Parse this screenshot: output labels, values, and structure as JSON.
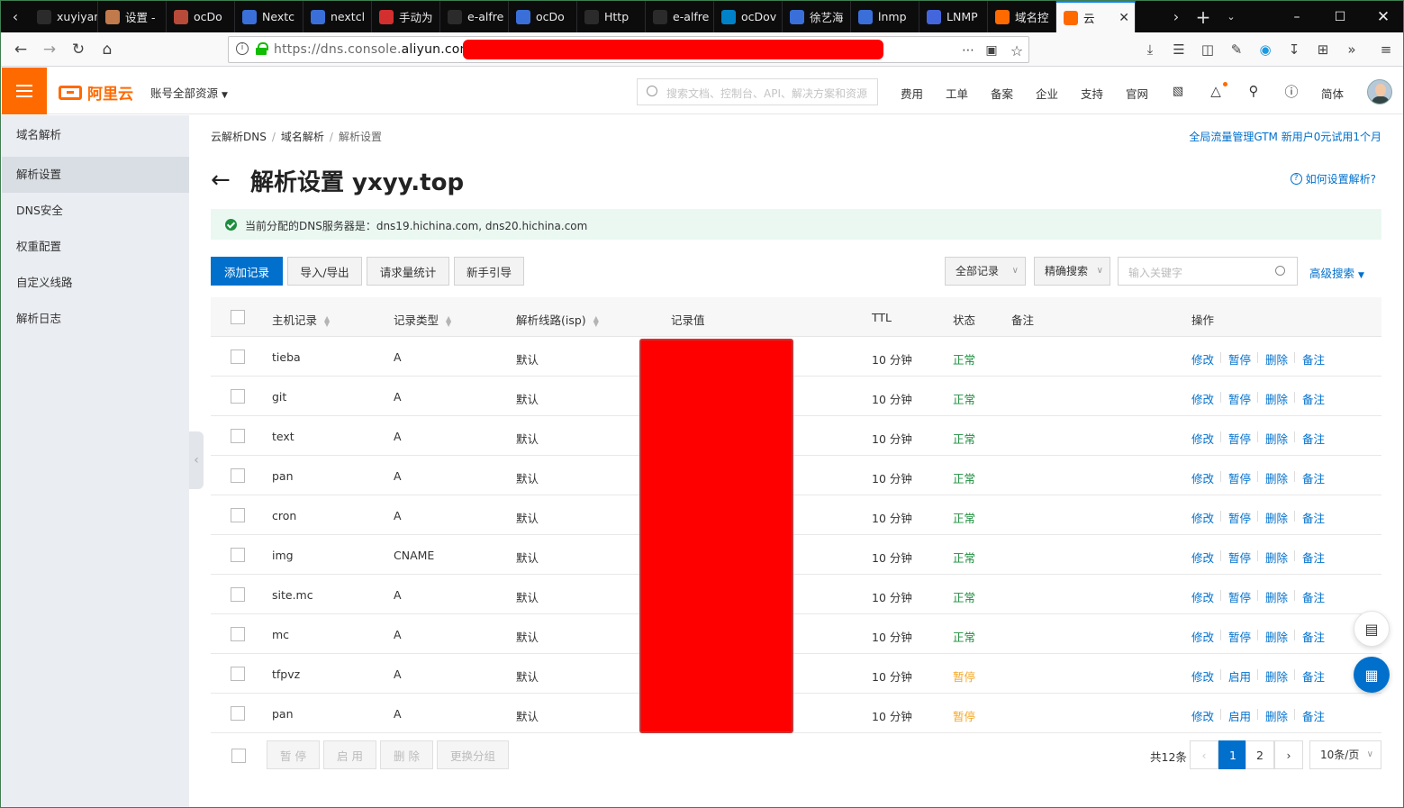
{
  "browser": {
    "tabs": [
      {
        "title": "xuyiyang",
        "color": "#2b2b2b"
      },
      {
        "title": "设置 -",
        "color": "#c07a4c"
      },
      {
        "title": "ocDo",
        "color": "#b84a3a"
      },
      {
        "title": "Nextc",
        "color": "#3a6fd9"
      },
      {
        "title": "nextcl",
        "color": "#3a6fd9"
      },
      {
        "title": "手动为",
        "color": "#d32f2f"
      },
      {
        "title": "e-alfre",
        "color": "#2b2b2b"
      },
      {
        "title": "ocDo",
        "color": "#3a6fd9"
      },
      {
        "title": "Http",
        "color": "#2b2b2b"
      },
      {
        "title": "e-alfre",
        "color": "#2b2b2b"
      },
      {
        "title": "ocDov",
        "color": "#0082c9"
      },
      {
        "title": "徐艺海",
        "color": "#3a6fd9"
      },
      {
        "title": "lnmp",
        "color": "#3a6fd9"
      },
      {
        "title": "LNMP",
        "color": "#4466dd"
      },
      {
        "title": "域名控",
        "color": "#ff6a00"
      }
    ],
    "active_tab": {
      "title": "云",
      "color": "#ff6a00"
    },
    "url_prefix": "https://dns.console.",
    "url_domain": "aliyun.com",
    "url_suffix": "/"
  },
  "header": {
    "logo_text": "阿里云",
    "account": "账号全部资源",
    "search_placeholder": "搜索文档、控制台、API、解决方案和资源",
    "nav": [
      "费用",
      "工单",
      "备案",
      "企业",
      "支持",
      "官网"
    ],
    "lang": "简体"
  },
  "sidebar": {
    "items": [
      "域名解析",
      "解析设置",
      "DNS安全",
      "权重配置",
      "自定义线路",
      "解析日志"
    ],
    "active_index": 1
  },
  "breadcrumb": [
    "云解析DNS",
    "域名解析",
    "解析设置"
  ],
  "promo": "全局流量管理GTM 新用户0元试用1个月",
  "page_title": "解析设置 yxyy.top",
  "help": "如何设置解析?",
  "alert": "当前分配的DNS服务器是：dns19.hichina.com, dns20.hichina.com",
  "toolbar": {
    "add": "添加记录",
    "import": "导入/导出",
    "stats": "请求量统计",
    "guide": "新手引导",
    "filter": "全部记录",
    "search_mode": "精确搜索",
    "keyword_placeholder": "输入关键字",
    "advanced": "高级搜索"
  },
  "table": {
    "columns": [
      "主机记录",
      "记录类型",
      "解析线路(isp)",
      "记录值",
      "TTL",
      "状态",
      "备注",
      "操作"
    ],
    "rows": [
      {
        "host": "tieba",
        "type": "A",
        "line": "默认",
        "ttl": "10 分钟",
        "status": "正常",
        "toggle": "暂停"
      },
      {
        "host": "git",
        "type": "A",
        "line": "默认",
        "ttl": "10 分钟",
        "status": "正常",
        "toggle": "暂停"
      },
      {
        "host": "text",
        "type": "A",
        "line": "默认",
        "ttl": "10 分钟",
        "status": "正常",
        "toggle": "暂停"
      },
      {
        "host": "pan",
        "type": "A",
        "line": "默认",
        "ttl": "10 分钟",
        "status": "正常",
        "toggle": "暂停"
      },
      {
        "host": "cron",
        "type": "A",
        "line": "默认",
        "ttl": "10 分钟",
        "status": "正常",
        "toggle": "暂停"
      },
      {
        "host": "img",
        "type": "CNAME",
        "line": "默认",
        "ttl": "10 分钟",
        "status": "正常",
        "toggle": "暂停"
      },
      {
        "host": "site.mc",
        "type": "A",
        "line": "默认",
        "ttl": "10 分钟",
        "status": "正常",
        "toggle": "暂停"
      },
      {
        "host": "mc",
        "type": "A",
        "line": "默认",
        "ttl": "10 分钟",
        "status": "正常",
        "toggle": "暂停"
      },
      {
        "host": "tfpvz",
        "type": "A",
        "line": "默认",
        "ttl": "10 分钟",
        "status": "暂停",
        "toggle": "启用"
      },
      {
        "host": "pan",
        "type": "A",
        "line": "默认",
        "ttl": "10 分钟",
        "status": "暂停",
        "toggle": "启用"
      }
    ],
    "actions": {
      "edit": "修改",
      "delete": "删除",
      "note": "备注"
    }
  },
  "footer": {
    "bulk": [
      "暂 停",
      "启 用",
      "删 除",
      "更换分组"
    ],
    "total": "共12条",
    "pages": [
      "1",
      "2"
    ],
    "current_page": "1",
    "page_size": "10条/页"
  },
  "colors": {
    "brand": "#ff6a00",
    "primary": "#0070cc",
    "ok": "#1e8e3e",
    "paused": "#f5a623",
    "redaction": "#ff0000"
  }
}
